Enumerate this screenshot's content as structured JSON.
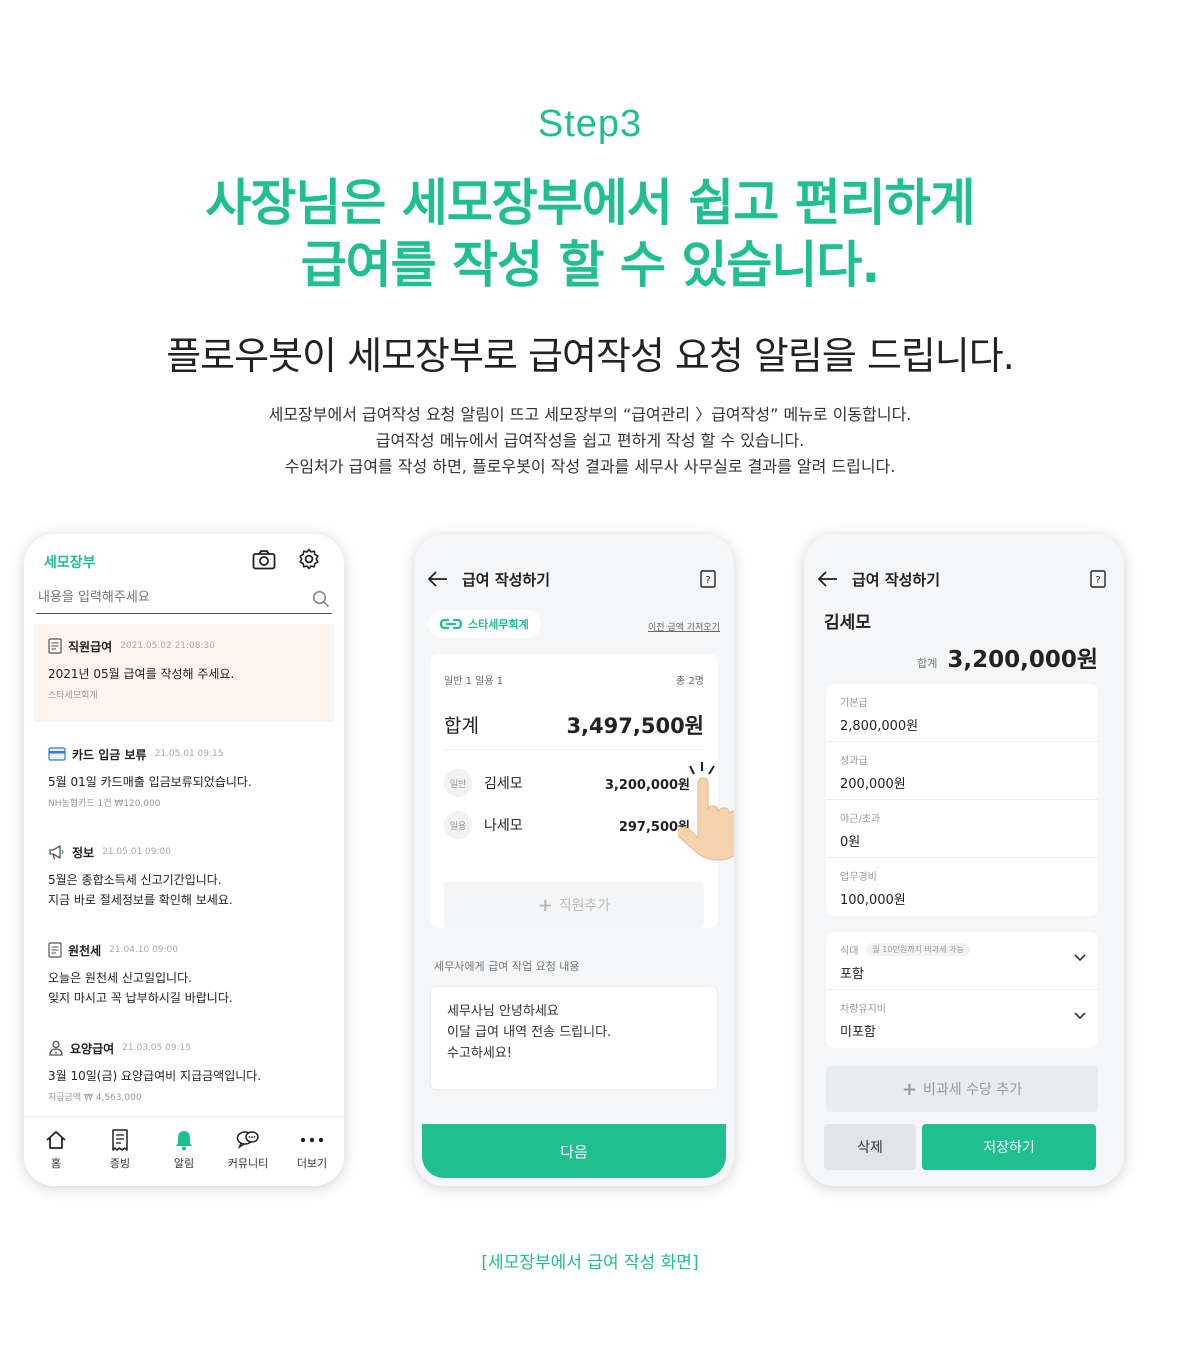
{
  "hero": {
    "step": "Step3",
    "headline_line1": "사장님은 세모장부에서 쉽고 편리하게",
    "headline_line2": "급여를 작성 할 수 있습니다.",
    "subhead": "플로우봇이 세모장부로 급여작성 요청 알림을 드립니다.",
    "desc_line1": "세모장부에서 급여작성 요청 알림이 뜨고 세모장부의 “급여관리 〉급여작성” 메뉴로 이동합니다.",
    "desc_line2": "급여작성 메뉴에서 급여작성을 쉽고 편하게 작성 할 수 있습니다.",
    "desc_line3": "수임처가 급여를 작성 하면, 플로우봇이 작성 결과를 세무사 사무실로 결과를 알려 드립니다.",
    "accent_color": "#1fbf8f",
    "highlight_color": "#f5ea1a"
  },
  "caption": "[세모장부에서 급여 작성 화면]",
  "phone1": {
    "logo": "세모장부",
    "icons": [
      "camera-icon",
      "gear-icon",
      "search-icon"
    ],
    "search_placeholder": "내용을 입력해주세요",
    "notifications": [
      {
        "icon": "document-icon",
        "title": "직원급여",
        "date": "2021.05.02 21:08:30",
        "body": "2021년 05월 급여를 작성해 주세요.",
        "sub": "스타세모회계",
        "highlighted": true
      },
      {
        "icon": "card-icon",
        "title": "카드 입금 보류",
        "date": "21.05.01  09:15",
        "body": "5월 01일 카드매출 입금보류되었습니다.",
        "sub": "NH농협카드 1건  ₩120,000"
      },
      {
        "icon": "megaphone-icon",
        "title": "정보",
        "date": "21.05.01  09:00",
        "body": "5월은 종합소득세 신고기간입니다.",
        "body2": "지금 바로 절세정보를 확인해 보세요."
      },
      {
        "icon": "document-icon",
        "title": "원천세",
        "date": "21.04.10  09:00",
        "body": "오늘은 원천세 신고일입니다.",
        "body2": "잊지 마시고 꼭 납부하시길 바랍니다."
      },
      {
        "icon": "caregiver-icon",
        "title": "요양급여",
        "date": "21.03.05  09:15",
        "body": "3월 10일(금) 요양급여비 지급금액입니다.",
        "sub": "지급금액 ₩ 4,563,000"
      }
    ],
    "tabs": [
      {
        "icon": "home-icon",
        "label": "홈"
      },
      {
        "icon": "receipt-icon",
        "label": "증빙"
      },
      {
        "icon": "bell-icon",
        "label": "알림",
        "active": true
      },
      {
        "icon": "chat-icon",
        "label": "커뮤니티"
      },
      {
        "icon": "more-icon",
        "label": "더보기"
      }
    ]
  },
  "phone2": {
    "title": "급여 작성하기",
    "company": "스타세무회계",
    "prev_link": "이전 금액 가져오기",
    "counts_left": "일반 1  일용 1",
    "counts_right": "총 2명",
    "total_label": "합계",
    "total_value": "3,497,500원",
    "employees": [
      {
        "type": "일반",
        "name": "김세모",
        "amount": "3,200,000원"
      },
      {
        "type": "일용",
        "name": "나세모",
        "amount": "297,500원"
      }
    ],
    "add_label": "직원추가",
    "request_label": "세무사에게 급여 작업 요청 내용",
    "request_text": "세무사님 안녕하세요\n이달 급여 내역 전송 드립니다.\n수고하세요!",
    "next_label": "다음"
  },
  "phone3": {
    "title": "급여 작성하기",
    "employee": "김세모",
    "total_label": "합계",
    "total_value": "3,200,000원",
    "pay_items": [
      {
        "label": "기본급",
        "value": "2,800,000원"
      },
      {
        "label": "성과급",
        "value": "200,000원"
      },
      {
        "label": "야근/초과",
        "value": "0원"
      },
      {
        "label": "업무경비",
        "value": "100,000원"
      }
    ],
    "selects": [
      {
        "label": "식대",
        "note": "월 10만원까지 비과세 가능",
        "value": "포함"
      },
      {
        "label": "차량유지비",
        "value": "미포함"
      }
    ],
    "nontax_label": "비과세 수당 추가",
    "delete_label": "삭제",
    "save_label": "저장하기"
  }
}
